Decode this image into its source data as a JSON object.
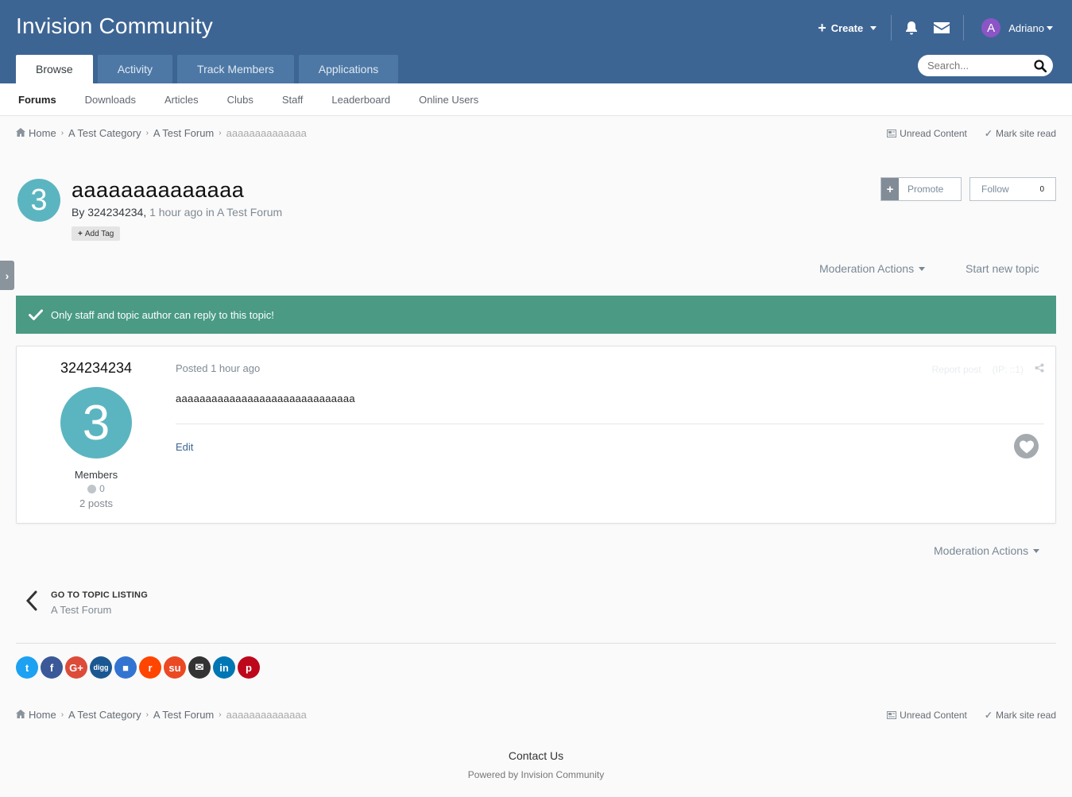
{
  "site": {
    "title": "Invision Community"
  },
  "user_bar": {
    "create_label": "Create",
    "username": "Adriano",
    "avatar_letter": "A"
  },
  "main_tabs": [
    {
      "label": "Browse"
    },
    {
      "label": "Activity"
    },
    {
      "label": "Track Members"
    },
    {
      "label": "Applications"
    }
  ],
  "search": {
    "placeholder": "Search..."
  },
  "sub_nav": [
    {
      "label": "Forums"
    },
    {
      "label": "Downloads"
    },
    {
      "label": "Articles"
    },
    {
      "label": "Clubs"
    },
    {
      "label": "Staff"
    },
    {
      "label": "Leaderboard"
    },
    {
      "label": "Online Users"
    }
  ],
  "breadcrumb": {
    "items": [
      "Home",
      "A Test Category",
      "A Test Forum"
    ],
    "current": "aaaaaaaaaaaaaa",
    "unread": "Unread Content",
    "mark_read": "Mark site read"
  },
  "topic": {
    "avatar_letter": "3",
    "title": "aaaaaaaaaaaaaa",
    "by_label": "By",
    "author": "324234234,",
    "time": "1 hour ago",
    "in_label": "in",
    "forum": "A Test Forum",
    "add_tag": "Add Tag",
    "promote": "Promote",
    "follow": "Follow",
    "follow_count": "0",
    "moderation": "Moderation Actions",
    "start_new": "Start new topic"
  },
  "message": {
    "text": "Only staff and topic author can reply to this topic!"
  },
  "post": {
    "author": "324234234",
    "avatar_letter": "3",
    "group": "Members",
    "reputation": "0",
    "posts": "2 posts",
    "posted": "Posted 1 hour ago",
    "report": "Report post",
    "ip": "(IP: ::1)",
    "body": "aaaaaaaaaaaaaaaaaaaaaaaaaaaaaa",
    "edit": "Edit"
  },
  "bottom": {
    "moderation": "Moderation Actions",
    "goto_title": "GO TO TOPIC LISTING",
    "goto_forum": "A Test Forum"
  },
  "shares": [
    {
      "name": "twitter",
      "glyph": "t",
      "color": "#1da1f2"
    },
    {
      "name": "facebook",
      "glyph": "f",
      "color": "#3b5998"
    },
    {
      "name": "google-plus",
      "glyph": "G+",
      "color": "#dd4b39"
    },
    {
      "name": "digg",
      "glyph": "digg",
      "color": "#1b5891"
    },
    {
      "name": "delicious",
      "glyph": "■",
      "color": "#3274d1"
    },
    {
      "name": "reddit",
      "glyph": "r",
      "color": "#ff4500"
    },
    {
      "name": "stumbleupon",
      "glyph": "su",
      "color": "#eb4924"
    },
    {
      "name": "email",
      "glyph": "✉",
      "color": "#333333"
    },
    {
      "name": "linkedin",
      "glyph": "in",
      "color": "#0077b5"
    },
    {
      "name": "pinterest",
      "glyph": "p",
      "color": "#bd081c"
    }
  ],
  "footer": {
    "contact": "Contact Us",
    "powered": "Powered by Invision Community"
  },
  "colors": {
    "header": "#3d6594",
    "message": "#4a9a84",
    "avatar": "#5bb5c0"
  }
}
